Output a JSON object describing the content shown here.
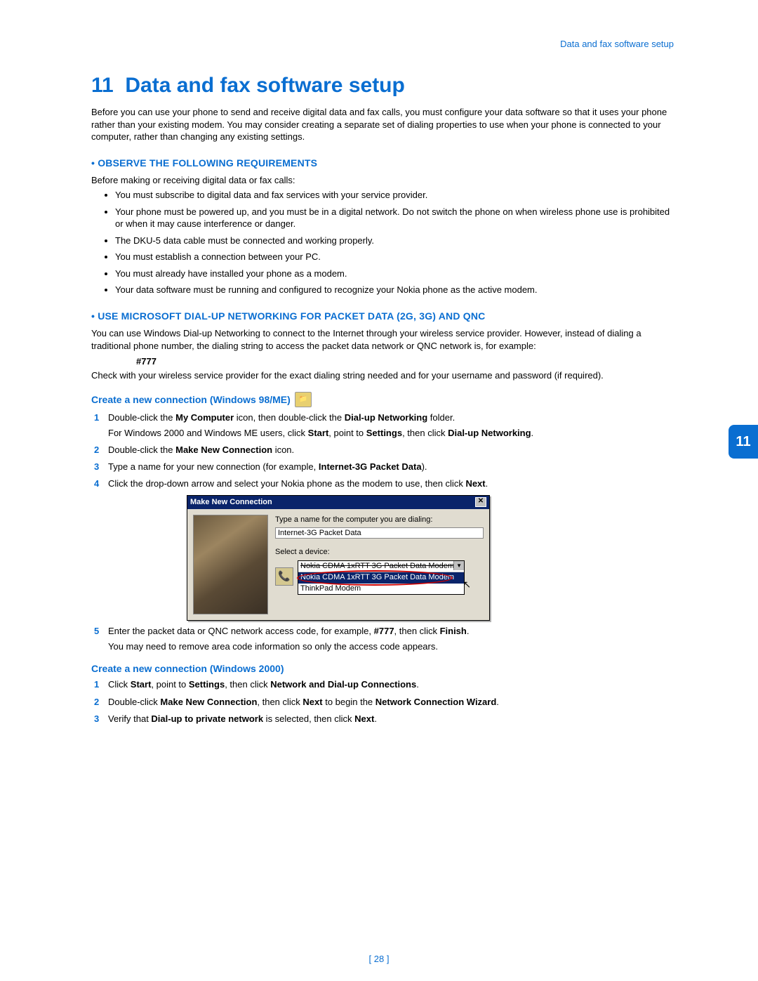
{
  "header": {
    "right": "Data and fax software setup"
  },
  "chapter": {
    "number": "11",
    "title": "Data and fax software setup"
  },
  "intro": "Before you can use your phone to send and receive digital data and fax calls, you must configure your data software so that it uses your phone rather than your existing modem. You may consider creating a separate set of dialing properties to use when your phone is connected to your computer, rather than changing any existing settings.",
  "sections": {
    "observe": {
      "heading": "• OBSERVE THE FOLLOWING REQUIREMENTS",
      "lead": "Before making or receiving digital data or fax calls:",
      "items": [
        "You must subscribe to digital data and fax services with your service provider.",
        "Your phone must be powered up, and you must be in a digital network. Do not switch the phone on when wireless phone use is prohibited or when it may cause interference or danger.",
        "The DKU-5 data cable must be connected and working properly.",
        "You must establish a connection between your PC.",
        "You must already have installed your phone as a modem.",
        "Your data software must be running and configured to recognize your Nokia phone as the active modem."
      ]
    },
    "dialup": {
      "heading": "• USE MICROSOFT DIAL-UP NETWORKING FOR PACKET DATA (2G, 3G) AND QNC",
      "para1": "You can use Windows Dial-up Networking to connect to the Internet through your wireless service provider. However, instead of dialing a traditional phone number, the dialing string to access the packet data network or QNC network is, for example:",
      "code": "#777",
      "para2": "Check with your wireless service provider for the exact dialing string needed and for your username and password (if required)."
    },
    "win98": {
      "heading": "Create a new connection (Windows 98/ME)",
      "steps": {
        "s1a": "Double-click the ",
        "s1b": "My Computer",
        "s1c": " icon, then double-click the ",
        "s1d": "Dial-up Networking",
        "s1e": " folder.",
        "s1sub_a": "For Windows 2000 and Windows ME users, click ",
        "s1sub_b": "Start",
        "s1sub_c": ", point to ",
        "s1sub_d": "Settings",
        "s1sub_e": ", then click ",
        "s1sub_f": "Dial-up Networking",
        "s1sub_g": ".",
        "s2a": "Double-click the ",
        "s2b": "Make New Connection",
        "s2c": " icon.",
        "s3a": "Type a name for your new connection (for example, ",
        "s3b": "Internet-3G Packet Data",
        "s3c": ").",
        "s4a": "Click the drop-down arrow and select your Nokia phone as the modem to use, then click ",
        "s4b": "Next",
        "s4c": ".",
        "s5a": "Enter the packet data or QNC network access code, for example, ",
        "s5b": "#777",
        "s5c": ", then click ",
        "s5d": "Finish",
        "s5e": ".",
        "s5sub": "You may need to remove area code information so only the access code appears."
      }
    },
    "dialog": {
      "title": "Make New Connection",
      "label1": "Type a name for the computer you are dialing:",
      "input1": "Internet-3G Packet Data",
      "label2": "Select a device:",
      "opt_sel": "Nokia CDMA 1xRTT 3G Packet Data Modem",
      "opt_hl": "Nokia CDMA 1xRTT 3G Packet Data Modem",
      "opt_other": "ThinkPad Modem"
    },
    "win2000": {
      "heading": "Create a new connection (Windows 2000)",
      "steps": {
        "s1a": "Click ",
        "s1b": "Start",
        "s1c": ", point to ",
        "s1d": "Settings",
        "s1e": ", then click ",
        "s1f": "Network and Dial-up Connections",
        "s1g": ".",
        "s2a": "Double-click ",
        "s2b": "Make New Connection",
        "s2c": ", then click ",
        "s2d": "Next",
        "s2e": " to begin the ",
        "s2f": "Network Connection Wizard",
        "s2g": ".",
        "s3a": "Verify that ",
        "s3b": "Dial-up to private network",
        "s3c": " is selected, then click ",
        "s3d": "Next",
        "s3e": "."
      }
    }
  },
  "side_tab": "11",
  "page_number": "[ 28 ]"
}
